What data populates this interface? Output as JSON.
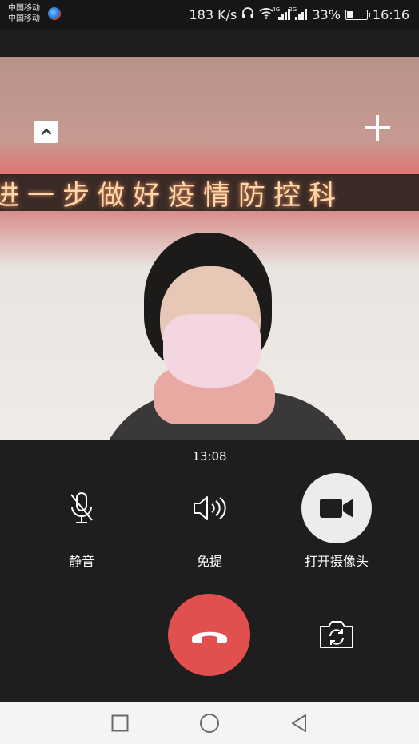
{
  "status_bar": {
    "carrier_1": "中国移动",
    "carrier_2": "中国移动",
    "speed": "183 K/s",
    "sim1_network": "4G",
    "sim2_network": "2G",
    "battery": "33%",
    "battery_level": 0.33,
    "time": "16:16",
    "icons": [
      "carrier-app-icon",
      "headset-icon",
      "wifi-icon",
      "signal-icon",
      "signal-icon",
      "battery-icon"
    ]
  },
  "video": {
    "banner_text": "进一步做好疫情防控科"
  },
  "call": {
    "duration": "13:08",
    "mute_label": "静音",
    "speaker_label": "免提",
    "camera_label": "打开摄像头"
  },
  "colors": {
    "background": "#1e1e1e",
    "hangup": "#e24f4f",
    "camera_button": "#ececec",
    "nav_bar": "#f4f4f4"
  },
  "nav": {
    "icons": [
      "recent-apps-icon",
      "home-icon",
      "back-icon"
    ]
  }
}
